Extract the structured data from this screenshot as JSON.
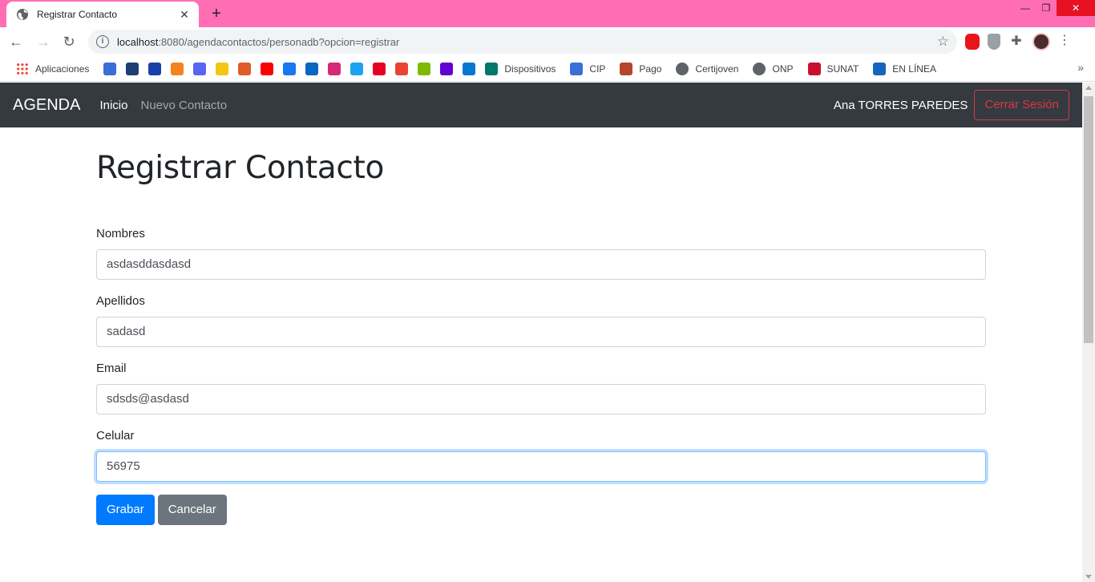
{
  "browser": {
    "tab_title": "Registrar Contacto",
    "url_host": "localhost",
    "url_rest": ":8080/agendacontactos/personadb?opcion=registrar",
    "bookmarks": [
      {
        "label": "Aplicaciones",
        "icon": "apps-grid-icon",
        "color": "#4285f4"
      },
      {
        "label": "",
        "icon": "globe-blue-icon",
        "color": "#3b6ed6"
      },
      {
        "label": "",
        "icon": "arcgis-icon",
        "color": "#1d3f72"
      },
      {
        "label": "",
        "icon": "square-blue-icon",
        "color": "#1a3fa8"
      },
      {
        "label": "",
        "icon": "orange-play-icon",
        "color": "#f58220"
      },
      {
        "label": "",
        "icon": "discord-icon",
        "color": "#5865f2"
      },
      {
        "label": "",
        "icon": "code-yellow-icon",
        "color": "#f2c811"
      },
      {
        "label": "",
        "icon": "wr-icon",
        "color": "#e05b2b"
      },
      {
        "label": "",
        "icon": "youtube-icon",
        "color": "#ff0000"
      },
      {
        "label": "",
        "icon": "facebook-icon",
        "color": "#1877f2"
      },
      {
        "label": "",
        "icon": "linkedin-icon",
        "color": "#0a66c2"
      },
      {
        "label": "",
        "icon": "instagram-icon",
        "color": "#d62976"
      },
      {
        "label": "",
        "icon": "twitter-icon",
        "color": "#1da1f2"
      },
      {
        "label": "",
        "icon": "pinterest-icon",
        "color": "#e60023"
      },
      {
        "label": "",
        "icon": "gmail-icon",
        "color": "#ea4335"
      },
      {
        "label": "",
        "icon": "microsoft-icon",
        "color": "#7fba00"
      },
      {
        "label": "",
        "icon": "yahoo-icon",
        "color": "#6001d2"
      },
      {
        "label": "",
        "icon": "outlook-icon",
        "color": "#0078d4"
      },
      {
        "label": "Dispositivos",
        "icon": "k-icon",
        "color": "#00796b"
      },
      {
        "label": "CIP",
        "icon": "cip-icon",
        "color": "#3a6fd8"
      },
      {
        "label": "Pago",
        "icon": "pago-icon",
        "color": "#b5452d"
      },
      {
        "label": "Certijoven",
        "icon": "globe-icon",
        "color": "#5f6368"
      },
      {
        "label": "ONP",
        "icon": "globe-icon",
        "color": "#5f6368"
      },
      {
        "label": "SUNAT",
        "icon": "sunat-icon",
        "color": "#c8102e"
      },
      {
        "label": "EN LÍNEA",
        "icon": "people-icon",
        "color": "#1565c0"
      }
    ]
  },
  "app": {
    "brand": "AGENDA",
    "nav": {
      "home": "Inicio",
      "new_contact": "Nuevo Contacto"
    },
    "user": "Ana TORRES PAREDES",
    "logout": "Cerrar Sesión"
  },
  "form": {
    "heading": "Registrar Contacto",
    "fields": [
      {
        "label": "Nombres",
        "value": "asdasddasdasd"
      },
      {
        "label": "Apellidos",
        "value": "sadasd"
      },
      {
        "label": "Email",
        "value": "sdsds@asdasd"
      },
      {
        "label": "Celular",
        "value": "56975"
      }
    ],
    "save": "Grabar",
    "cancel": "Cancelar"
  },
  "colors": {
    "tabstrip": "#ff6eb4",
    "navbar": "#343a40",
    "primary": "#007bff",
    "secondary": "#6c757d",
    "danger": "#dc3545"
  }
}
